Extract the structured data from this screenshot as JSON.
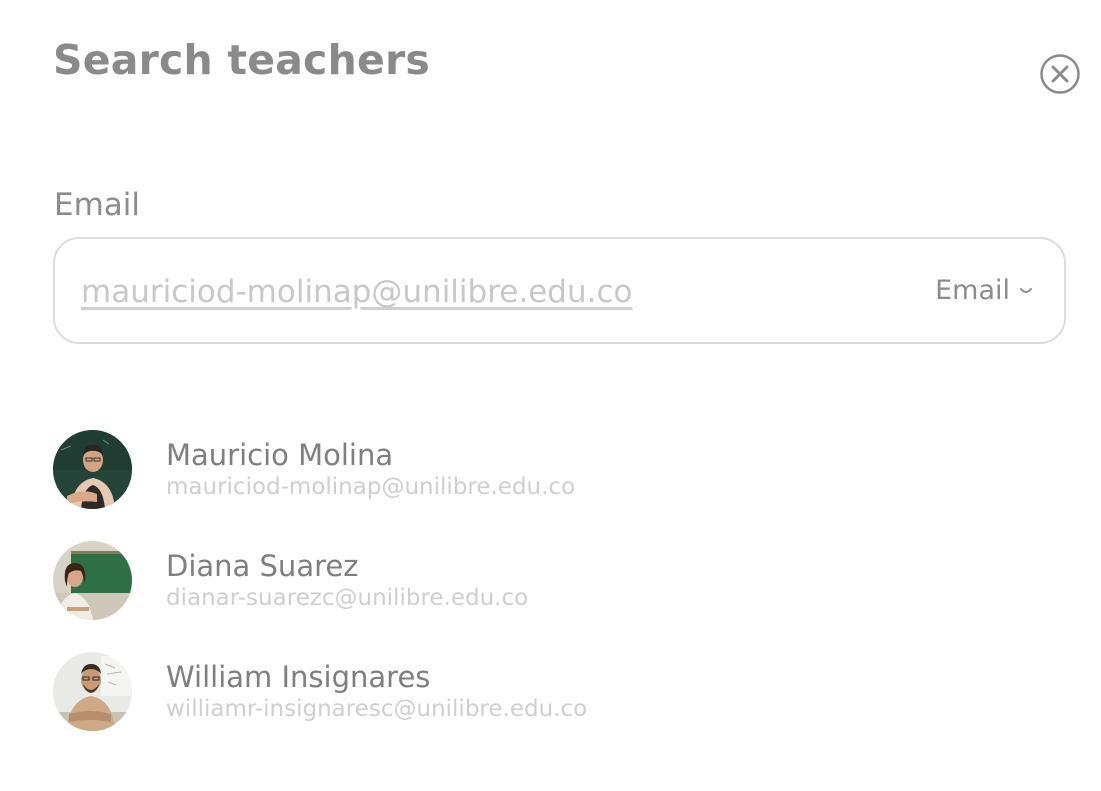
{
  "dialog": {
    "title": "Search teachers",
    "close_icon": "close-circle-icon"
  },
  "search": {
    "label": "Email",
    "value": "mauriciod-molinap@unilibre.edu.co",
    "type_selected": "Email",
    "type_icon": "chevron-down-icon"
  },
  "results": [
    {
      "name": "Mauricio Molina",
      "email": "mauriciod-molinap@unilibre.edu.co"
    },
    {
      "name": "Diana Suarez",
      "email": "dianar-suarezc@unilibre.edu.co"
    },
    {
      "name": "William Insignares",
      "email": "williamr-insignaresc@unilibre.edu.co"
    }
  ]
}
